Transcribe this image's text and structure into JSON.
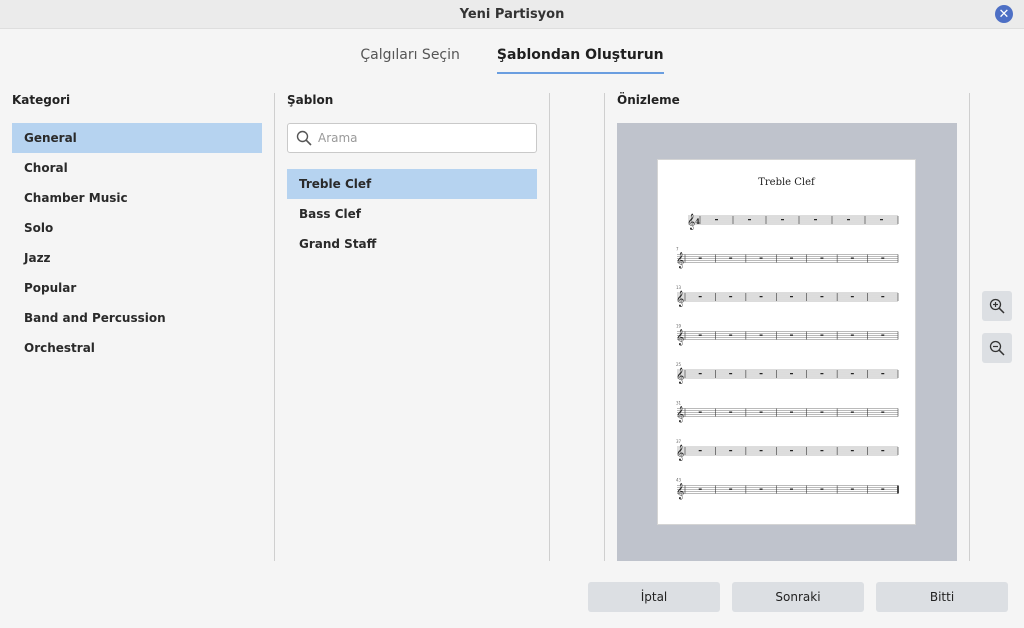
{
  "window": {
    "title": "Yeni Partisyon"
  },
  "tabs": [
    {
      "label": "Çalgıları Seçin"
    },
    {
      "label": "Şablondan Oluşturun"
    }
  ],
  "category": {
    "heading": "Kategori",
    "items": [
      "General",
      "Choral",
      "Chamber Music",
      "Solo",
      "Jazz",
      "Popular",
      "Band and Percussion",
      "Orchestral"
    ],
    "selected": "General"
  },
  "template": {
    "heading": "Şablon",
    "search_placeholder": "Arama",
    "items": [
      "Treble Clef",
      "Bass Clef",
      "Grand Staff"
    ],
    "selected": "Treble Clef"
  },
  "preview": {
    "heading": "Önizleme",
    "score_title": "Treble Clef",
    "measure_numbers": [
      "7",
      "13",
      "19",
      "25",
      "31",
      "37",
      "43"
    ]
  },
  "buttons": {
    "cancel": "İptal",
    "next": "Sonraki",
    "finish": "Bitti"
  },
  "icons": {
    "close": "close-icon",
    "search": "search-icon",
    "zoom_in": "zoom-in-icon",
    "zoom_out": "zoom-out-icon"
  },
  "colors": {
    "accent": "#4d6fc5",
    "selection": "#b6d3f0",
    "tab_underline": "#6a9ee0"
  }
}
